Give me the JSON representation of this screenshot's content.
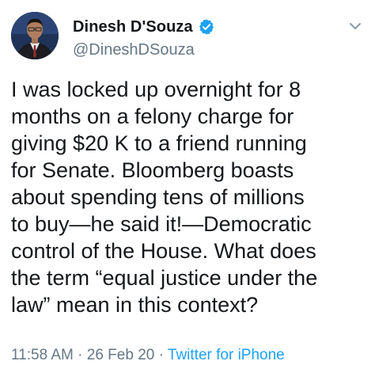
{
  "tweet": {
    "display_name": "Dinesh D'Souza",
    "handle": "@DineshDSouza",
    "verified": true,
    "text": "I was locked up overnight for 8\nmonths on a felony charge for\ngiving $20 K to a friend running\nfor Senate. Bloomberg boasts\nabout spending tens of millions\nto buy—he said it!—Democratic\ncontrol of the House. What does\nthe term “equal justice under the\nlaw” mean in this context?",
    "time": "11:58 AM",
    "separator": "·",
    "date": "26 Feb 20",
    "source": "Twitter for iPhone"
  },
  "icons": {
    "verified": "verified-badge-icon",
    "menu": "chevron-down-icon"
  },
  "colors": {
    "text": "#14171a",
    "secondary": "#657786",
    "link": "#1da1f2",
    "verified": "#1da1f2"
  }
}
